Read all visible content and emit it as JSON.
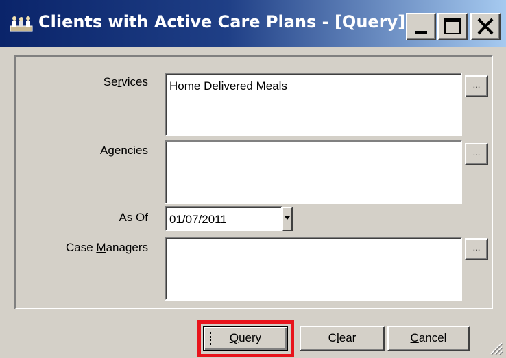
{
  "window": {
    "title": "Clients with Active Care Plans - [Query]",
    "icon": "app-people-icon",
    "controls": [
      "minimize-icon",
      "maximize-icon",
      "close-icon"
    ]
  },
  "form": {
    "services": {
      "label_pre": "Se",
      "label_mn": "r",
      "label_post": "vices",
      "value": "Home Delivered Meals",
      "browse_label": "..."
    },
    "agencies": {
      "label_pre": "A",
      "label_mn": "g",
      "label_post": "encies",
      "value": "",
      "browse_label": "..."
    },
    "as_of": {
      "label_pre": "",
      "label_mn": "A",
      "label_post": "s Of",
      "value": "01/07/2011"
    },
    "case_managers": {
      "label_pre": "Case ",
      "label_mn": "M",
      "label_post": "anagers",
      "value": "",
      "browse_label": "..."
    }
  },
  "buttons": {
    "query": {
      "pre": "",
      "mn": "Q",
      "post": "uery"
    },
    "clear": {
      "pre": "C",
      "mn": "l",
      "post": "ear"
    },
    "cancel": {
      "pre": "",
      "mn": "C",
      "post": "ancel"
    }
  },
  "colors": {
    "title_gradient_start": "#0a246a",
    "title_gradient_end": "#a6caf0",
    "dialog_face": "#d4d0c8",
    "highlight": "#e8141c"
  }
}
